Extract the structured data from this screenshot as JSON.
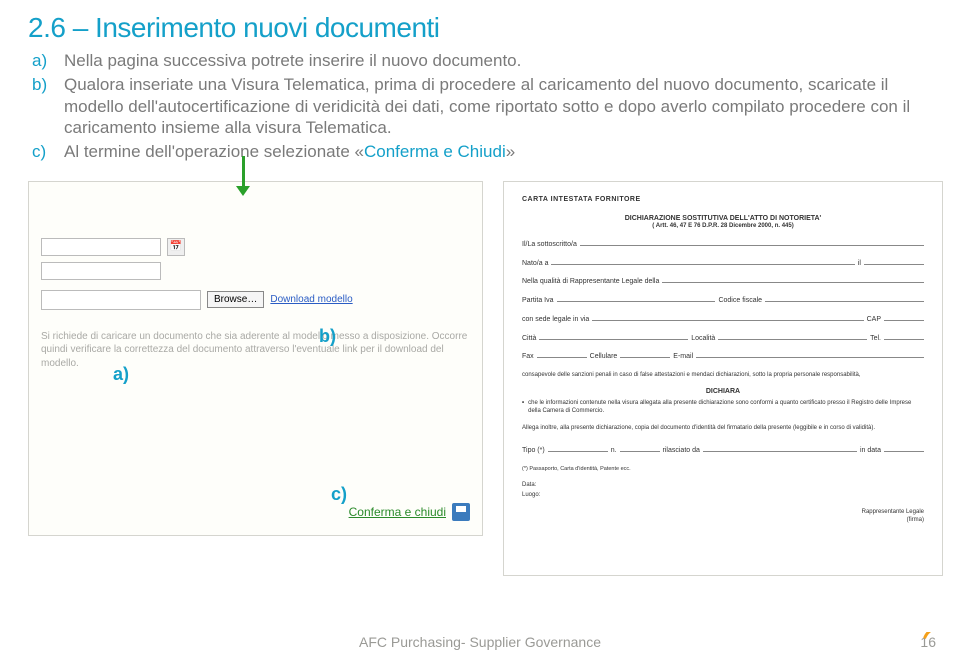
{
  "heading": "2.6 – Inserimento nuovi documenti",
  "items": {
    "a": {
      "bullet": "a)",
      "text": "Nella pagina successiva potrete inserire il nuovo documento."
    },
    "b": {
      "bullet": "b)",
      "text": "Qualora inseriate una Visura Telematica, prima di procedere al caricamento del nuovo documento, scaricate il modello dell'autocertificazione di veridicità dei dati, come riportato sotto e dopo averlo compilato procedere con il caricamento insieme alla visura Telematica."
    },
    "c": {
      "bullet": "c)",
      "pre": "Al termine dell'operazione selezionate «",
      "hl": "Conferma e Chiudi",
      "post": "»"
    }
  },
  "form": {
    "browse": "Browse…",
    "download_link": "Download modello",
    "hint": "Si richiede di caricare un documento che sia aderente al modello messo a disposizione. Occorre quindi verificare la correttezza del documento attraverso l'eventuale link per il download del modello.",
    "confirm": "Conferma e chiudi"
  },
  "markers": {
    "a": "a)",
    "b": "b)",
    "c": "c)"
  },
  "doc": {
    "header": "CARTA INTESTATA FORNITORE",
    "decl_title": "DICHIARAZIONE SOSTITUTIVA DELL'ATTO DI NOTORIETA'",
    "decl_sub": "( Artt. 46, 47 E 76 D.P.R. 28 Dicembre 2000, n. 445)",
    "f1": "Il/La sottoscritto/a",
    "f2a": "Nato/a a",
    "f2b": "il",
    "f3": "Nella qualità di Rappresentante Legale della",
    "f4a": "Partita Iva",
    "f4b": "Codice fiscale",
    "f5a": "con sede legale in via",
    "f5b": "CAP",
    "f6a": "Città",
    "f6b": "Località",
    "f6c": "Tel.",
    "f7a": "Fax",
    "f7b": "Cellulare",
    "f7c": "E-mail",
    "para1": "consapevole delle sanzioni penali in caso di false attestazioni e mendaci dichiarazioni, sotto la propria personale responsabilità,",
    "dich": "DICHIARA",
    "bul1": "che le informazioni contenute nella visura allegata alla presente dichiarazione sono conformi a quanto certificato presso il Registro delle Imprese della Camera di Commercio.",
    "para2": "Allega inoltre, alla presente dichiarazione, copia del documento d'identità del firmatario della presente (leggibile e in corso di validità).",
    "tipo_a": "Tipo (*)",
    "tipo_b": "n.",
    "tipo_c": "rilasciato da",
    "tipo_d": "in data",
    "tipo_note": "(*) Passaporto, Carta d'identità, Patente ecc.",
    "data": "Data:",
    "luogo": "Luogo:",
    "sig1": "Rappresentante Legale",
    "sig2": "(firma)"
  },
  "footer": "AFC Purchasing- Supplier Governance",
  "page": "16"
}
